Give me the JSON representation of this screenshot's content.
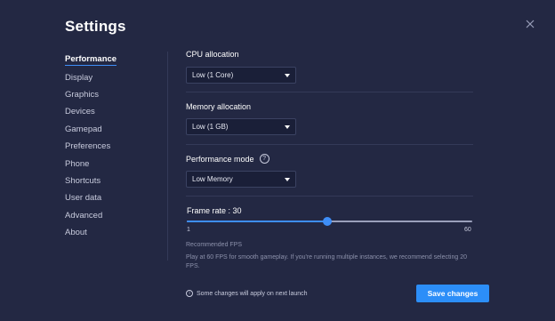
{
  "header": {
    "title": "Settings"
  },
  "sidebar": {
    "items": [
      {
        "label": "Performance",
        "active": true
      },
      {
        "label": "Display"
      },
      {
        "label": "Graphics"
      },
      {
        "label": "Devices"
      },
      {
        "label": "Gamepad"
      },
      {
        "label": "Preferences"
      },
      {
        "label": "Phone"
      },
      {
        "label": "Shortcuts"
      },
      {
        "label": "User data"
      },
      {
        "label": "Advanced"
      },
      {
        "label": "About"
      }
    ]
  },
  "performance": {
    "cpu": {
      "label": "CPU allocation",
      "value": "Low (1 Core)"
    },
    "memory": {
      "label": "Memory allocation",
      "value": "Low (1 GB)"
    },
    "mode": {
      "label": "Performance mode",
      "help_icon": "?",
      "value": "Low Memory"
    },
    "frame_rate": {
      "label": "Frame rate : 30",
      "min": 1,
      "max": 60,
      "value": 30,
      "min_label": "1",
      "max_label": "60"
    },
    "recommended": {
      "title": "Recommended FPS",
      "body": "Play at 60 FPS for smooth gameplay. If you're running multiple instances, we recommend selecting 20 FPS."
    }
  },
  "footer": {
    "note": "Some changes will apply on next launch",
    "save_label": "Save changes"
  },
  "icons": {
    "close": "close-icon",
    "info": "info-icon",
    "help": "help-icon",
    "caret": "chevron-down-icon"
  },
  "colors": {
    "background": "#232843",
    "accent": "#2c8ef8"
  }
}
